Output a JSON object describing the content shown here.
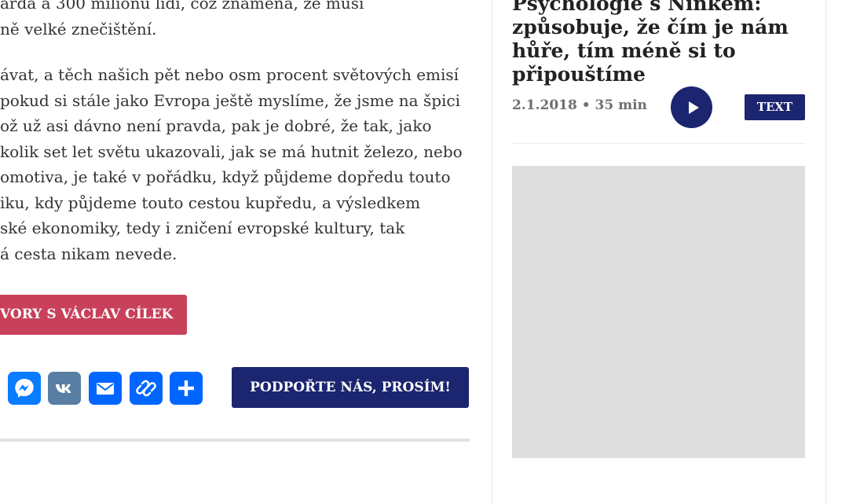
{
  "article": {
    "paragraph1": [
      "arda a 300 milionů lidí, což znamená, že musí",
      "ně velké znečištění."
    ],
    "paragraph2": [
      "ávat, a těch našich pět nebo osm procent světových emisí",
      "pokud si stále jako Evropa ještě myslíme, že jsme na špici",
      "ož už asi dávno není pravda, pak je dobré, že tak, jako",
      "kolik set let světu ukazovali, jak se má hutnit železo, nebo",
      "omotiva, je také v pořádku, když půjdeme dopředu touto",
      "iku, kdy půjdeme touto cestou kupředu, a výsledkem",
      "ské ekonomiky, tedy i zničení evropské kultury, tak",
      "á cesta nikam nevede."
    ],
    "tag_button": "VORY S VÁCLAV CÍLEK",
    "support_button": "PODPOŘTE NÁS, PROSÍM!"
  },
  "share": {
    "buttons": [
      {
        "icon": "messenger-icon",
        "color": "#0a7cff"
      },
      {
        "icon": "vk-icon",
        "color": "#587ea3"
      },
      {
        "icon": "email-icon",
        "color": "#0166ff"
      },
      {
        "icon": "copy-link-icon",
        "color": "#0166ff"
      },
      {
        "icon": "share-plus-icon",
        "color": "#0166ff"
      }
    ]
  },
  "sidebar": {
    "title_lines": [
      "Psychologie s Ninkem:",
      "způsobuje, že čím je nám",
      "hůře, tím méně si to",
      "připouštíme"
    ],
    "meta": "2.1.2018 • 35 min",
    "text_badge": "TEXT"
  },
  "colors": {
    "accent_navy": "#1b2570",
    "tag_red": "#c8405a",
    "placeholder_gray": "#dedede"
  }
}
